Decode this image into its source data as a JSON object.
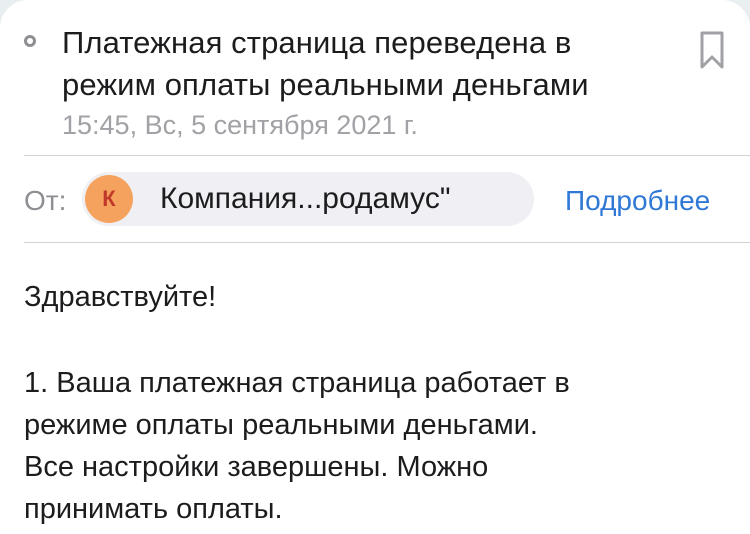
{
  "message": {
    "subject": "Платежная страница переведена в режим оплаты реальными деньгами",
    "date": "15:45, Вс, 5 сентября 2021 г.",
    "from_label": "От:",
    "sender": {
      "initial": "К",
      "name": "Компания...родамус\"",
      "avatar_color": "#f5a25f"
    },
    "details_link": "Подробнее",
    "body": {
      "greeting": "Здравствуйте!",
      "paragraph_1_lines": [
        "1. Ваша платежная страница работает в",
        "режиме оплаты реальными деньгами.",
        "Все настройки завершены. Можно",
        "принимать оплаты."
      ]
    }
  },
  "icons": {
    "status": "unread-dot-icon",
    "flag": "bookmark-icon"
  },
  "colors": {
    "link": "#2f78d6",
    "secondary_text": "#8e8e93",
    "chip_background": "#efeff4"
  }
}
